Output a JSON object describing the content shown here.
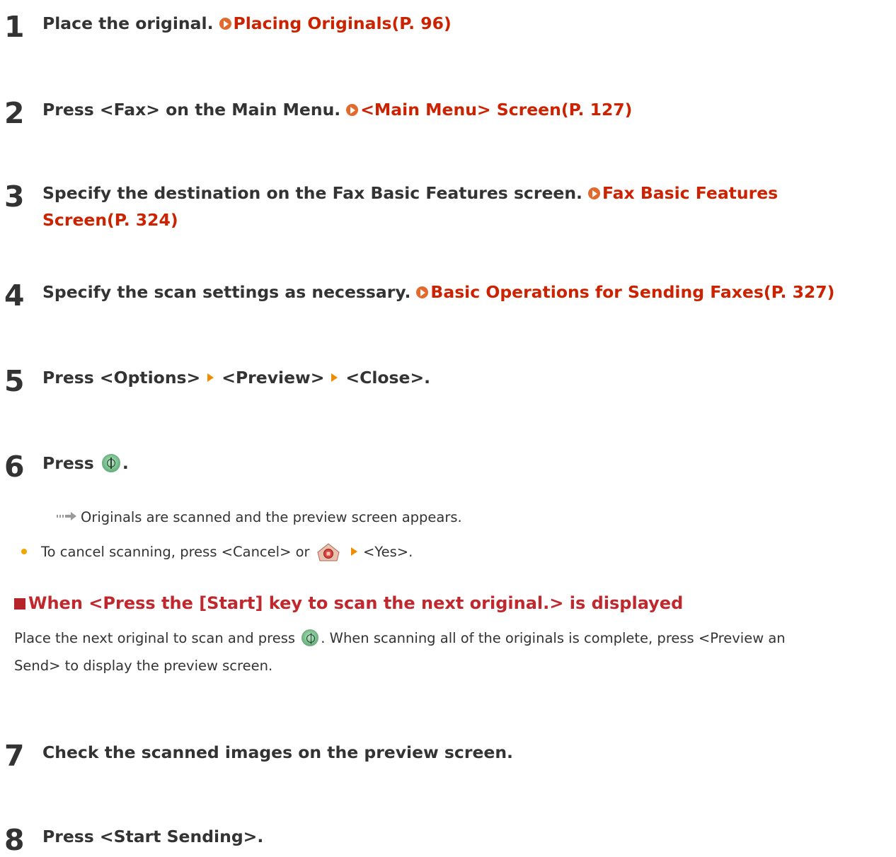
{
  "steps": [
    {
      "num": "1",
      "text": "Place the original.",
      "link": "Placing Originals(P. 96)"
    },
    {
      "num": "2",
      "text": "Press <Fax> on the Main Menu.",
      "link": "<Main Menu> Screen(P. 127)"
    },
    {
      "num": "3",
      "text": "Specify the destination on the Fax Basic Features screen.",
      "link_line1": "Fax Basic Features",
      "link_line2": "Screen(P. 324)"
    },
    {
      "num": "4",
      "text": "Specify the scan settings as necessary.",
      "link": "Basic Operations for Sending Faxes(P. 327)"
    },
    {
      "num": "5",
      "part1": "Press <Options>",
      "part2": "<Preview>",
      "part3": "<Close>."
    },
    {
      "num": "6",
      "text_before": "Press",
      "text_after": "."
    },
    {
      "num": "7",
      "text": "Check the scanned images on the preview screen."
    },
    {
      "num": "8",
      "text": "Press <Start Sending>."
    }
  ],
  "step6": {
    "result": "Originals are scanned and the preview screen appears.",
    "bullet_before": "To cancel scanning, press <Cancel> or",
    "bullet_after": "<Yes>."
  },
  "subsection": {
    "heading": "When <Press the [Start] key to scan the next original.> is displayed",
    "para_before": "Place the next original to scan and press",
    "para_after_line1": ". When scanning all of the originals is complete, press <Preview an",
    "para_line2": "Send> to display the preview screen."
  },
  "icons": {
    "link_icon": "arrow-link-icon",
    "separator_icon": "orange-triangle-icon",
    "start_icon": "start-key-icon",
    "stop_icon": "stop-key-icon",
    "result_icon": "result-arrow-icon"
  },
  "colors": {
    "link": "#cc2200",
    "heading": "#c0282d",
    "bullet": "#f0a500",
    "start_key": "#63b57b"
  }
}
